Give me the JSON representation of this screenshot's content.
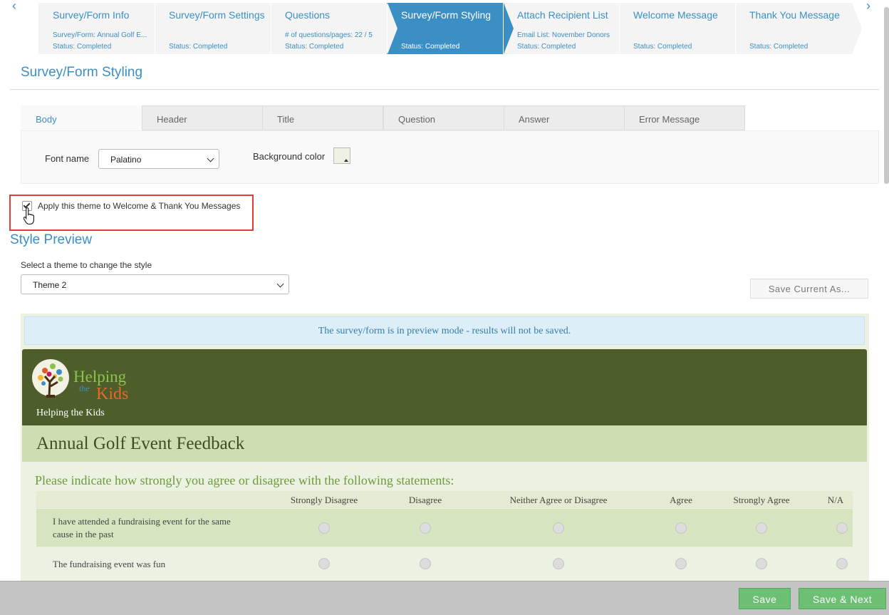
{
  "wizard": {
    "steps": [
      {
        "title": "Survey/Form Info",
        "line1": "Survey/Form: Annual Golf E...",
        "line2": "Status: Completed"
      },
      {
        "title": "Survey/Form Settings",
        "line1": "",
        "line2": "Status: Completed"
      },
      {
        "title": "Questions",
        "line1": "# of questions/pages: 22 / 5",
        "line2": "Status: Completed"
      },
      {
        "title": "Survey/Form Styling",
        "line1": "",
        "line2": "Status: Completed"
      },
      {
        "title": "Attach Recipient List",
        "line1": "Email List: November Donors",
        "line2": "Status: Completed"
      },
      {
        "title": "Welcome Message",
        "line1": "",
        "line2": "Status: Completed"
      },
      {
        "title": "Thank You Message",
        "line1": "",
        "line2": "Status: Completed"
      }
    ],
    "prev_icon": "chevron-left-icon",
    "next_icon": "chevron-right-icon",
    "active_color": "#3b8fc5"
  },
  "page": {
    "title": "Survey/Form Styling"
  },
  "styling": {
    "tabs": [
      "Body",
      "Header",
      "Title",
      "Question",
      "Answer",
      "Error Message"
    ],
    "font_label": "Font name",
    "font_value": "Palatino",
    "bg_color_label": "Background color",
    "bg_color_value": "#eef1e4"
  },
  "apply_theme": {
    "label": "Apply this theme to Welcome & Thank You Messages",
    "checked": true
  },
  "preview": {
    "section_title": "Style Preview",
    "theme_label": "Select a theme to change the style",
    "theme_value": "Theme 2",
    "save_as_label": "Save Current As...",
    "notice": "The survey/form is in preview mode - results will not be saved.",
    "logo": {
      "word1": "Helping",
      "word2": "the",
      "word3": "Kids"
    },
    "org_name": "Helping the Kids",
    "survey_title": "Annual Golf Event Feedback",
    "instructions": "Please indicate how strongly you agree or disagree with the following statements:",
    "columns": [
      "Strongly Disagree",
      "Disagree",
      "Neither Agree or Disagree",
      "Agree",
      "Strongly Agree",
      "N/A"
    ],
    "rows": [
      {
        "text": "I have attended a fundraising event for the same cause in the past"
      },
      {
        "text": "The fundraising event was fun"
      }
    ],
    "banner_color": "#4e5e2a",
    "title_band_color": "#cfdeb2"
  },
  "footer": {
    "save_label": "Save",
    "save_next_label": "Save & Next",
    "button_color": "#6cbf73"
  }
}
